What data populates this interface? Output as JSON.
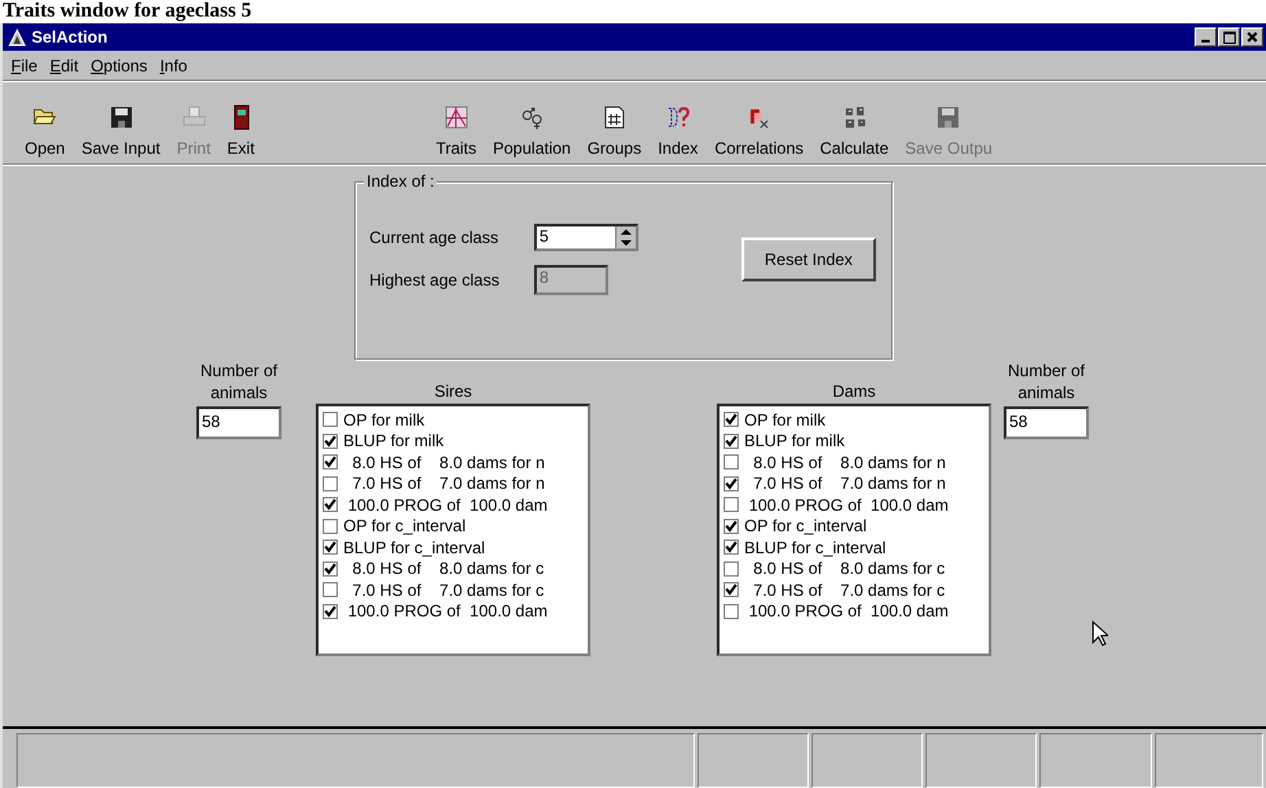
{
  "caption": "Traits window for ageclass 5",
  "window": {
    "title": "SelAction"
  },
  "menu": [
    {
      "label": "File"
    },
    {
      "label": "Edit"
    },
    {
      "label": "Options"
    },
    {
      "label": "Info"
    }
  ],
  "toolbar": {
    "file_tools": [
      {
        "kind": "open",
        "label": "Open",
        "disabled": false
      },
      {
        "kind": "save",
        "label": "Save Input",
        "disabled": false
      },
      {
        "kind": "print",
        "label": "Print",
        "disabled": true
      },
      {
        "kind": "exit",
        "label": "Exit",
        "disabled": false
      }
    ],
    "run_tools": [
      {
        "kind": "traits",
        "label": "Traits",
        "disabled": false
      },
      {
        "kind": "population",
        "label": "Population",
        "disabled": false
      },
      {
        "kind": "groups",
        "label": "Groups",
        "disabled": false
      },
      {
        "kind": "index",
        "label": "Index",
        "disabled": false
      },
      {
        "kind": "correlations",
        "label": "Correlations",
        "disabled": false
      },
      {
        "kind": "calculate",
        "label": "Calculate",
        "disabled": false
      },
      {
        "kind": "save",
        "label": "Save Outpu",
        "disabled": true
      }
    ]
  },
  "index_group": {
    "title": "Index of :",
    "current_label": "Current age class",
    "current_value": "5",
    "highest_label": "Highest age class",
    "highest_value": "8",
    "highest_disabled": true,
    "reset_button": "Reset Index"
  },
  "sires": {
    "count_label": "Number of animals",
    "count_value": "58",
    "title": "Sires",
    "items": [
      {
        "label": "OP for milk",
        "checked": false
      },
      {
        "label": "BLUP for milk",
        "checked": true
      },
      {
        "label": "  8.0 HS of    8.0 dams for n",
        "checked": true
      },
      {
        "label": "  7.0 HS of    7.0 dams for n",
        "checked": false
      },
      {
        "label": " 100.0 PROG of  100.0 dam",
        "checked": true
      },
      {
        "label": "OP for c_interval",
        "checked": false
      },
      {
        "label": "BLUP for c_interval",
        "checked": true
      },
      {
        "label": "  8.0 HS of    8.0 dams for c",
        "checked": true
      },
      {
        "label": "  7.0 HS of    7.0 dams for c",
        "checked": false
      },
      {
        "label": " 100.0 PROG of  100.0 dam",
        "checked": true
      }
    ]
  },
  "dams": {
    "count_label": "Number of animals",
    "count_value": "58",
    "title": "Dams",
    "items": [
      {
        "label": "OP for milk",
        "checked": true
      },
      {
        "label": "BLUP for milk",
        "checked": true
      },
      {
        "label": "  8.0 HS of    8.0 dams for n",
        "checked": false
      },
      {
        "label": "  7.0 HS of    7.0 dams for n",
        "checked": true
      },
      {
        "label": " 100.0 PROG of  100.0 dam",
        "checked": false
      },
      {
        "label": "OP for c_interval",
        "checked": true
      },
      {
        "label": "BLUP for c_interval",
        "checked": true
      },
      {
        "label": "  8.0 HS of    8.0 dams for c",
        "checked": false
      },
      {
        "label": "  7.0 HS of    7.0 dams for c",
        "checked": true
      },
      {
        "label": " 100.0 PROG of  100.0 dam",
        "checked": false
      }
    ]
  }
}
